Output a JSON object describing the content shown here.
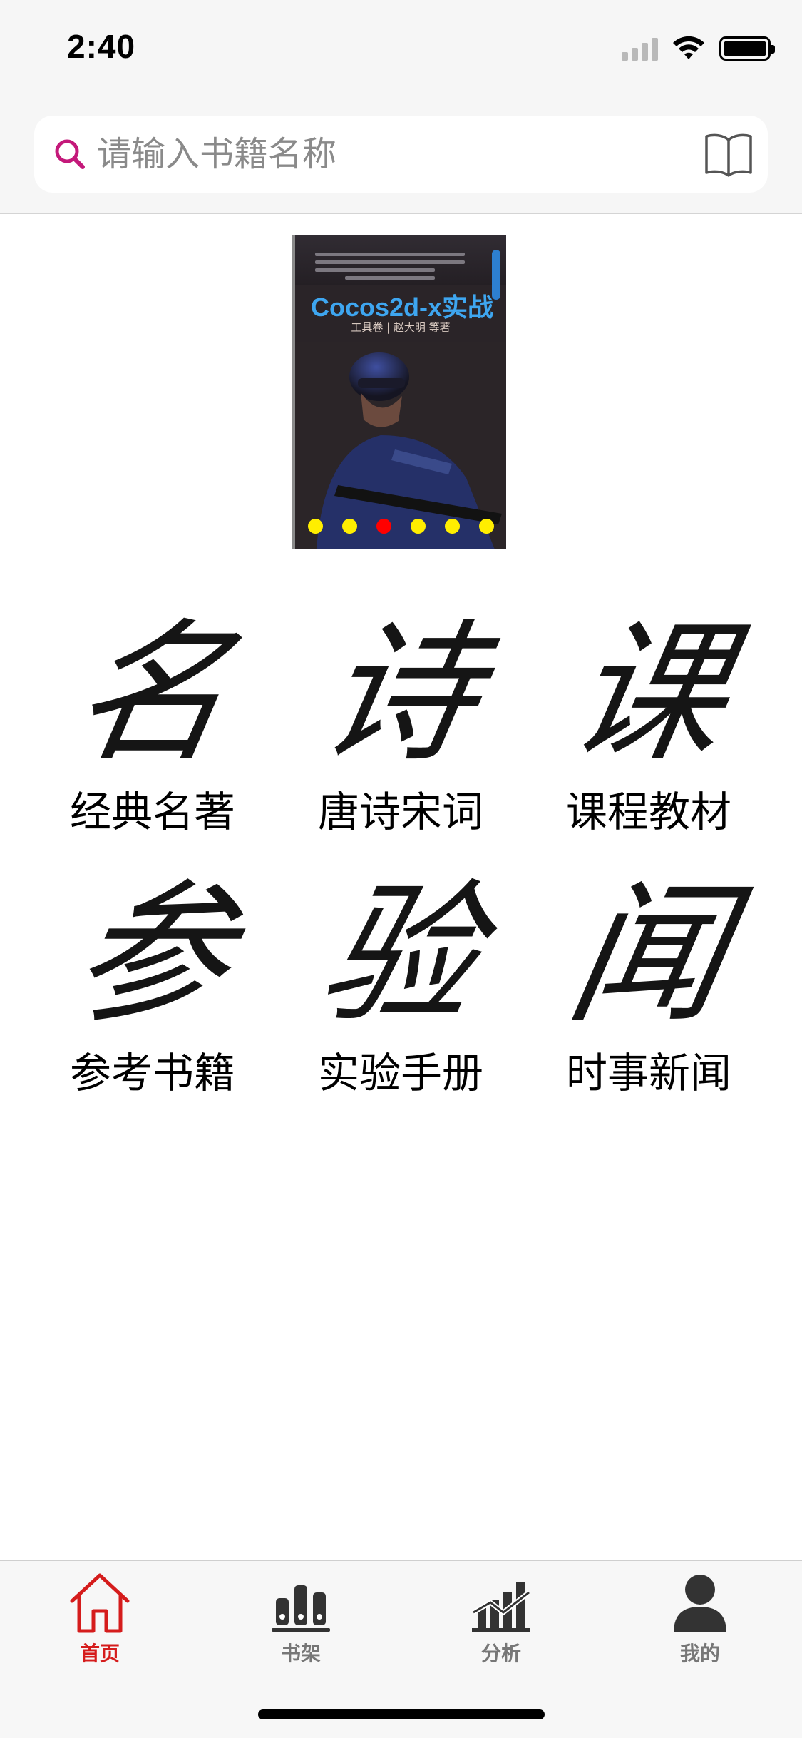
{
  "status_bar": {
    "time": "2:40"
  },
  "search": {
    "placeholder": "请输入书籍名称",
    "value": ""
  },
  "banner": {
    "title": "Cocos2d-x实战",
    "subtitle": "工具卷 | 赵大明 等著",
    "slide_count": 6,
    "active_slide": 3
  },
  "categories": [
    {
      "glyph": "名",
      "label": "经典名著"
    },
    {
      "glyph": "诗",
      "label": "唐诗宋词"
    },
    {
      "glyph": "课",
      "label": "课程教材"
    },
    {
      "glyph": "参",
      "label": "参考书籍"
    },
    {
      "glyph": "验",
      "label": "实验手册"
    },
    {
      "glyph": "闻",
      "label": "时事新闻"
    }
  ],
  "tab_bar": {
    "tabs": [
      {
        "label": "首页",
        "icon": "home-icon",
        "active": true
      },
      {
        "label": "书架",
        "icon": "bookshelf-icon",
        "active": false
      },
      {
        "label": "分析",
        "icon": "analysis-chart-icon",
        "active": false
      },
      {
        "label": "我的",
        "icon": "profile-icon",
        "active": false
      }
    ]
  },
  "colors": {
    "accent": "#d51c1c",
    "search_icon": "#c4197a",
    "tab_inactive": "#333333",
    "dot_inactive": "#ffee00",
    "dot_active": "#ff0000"
  }
}
